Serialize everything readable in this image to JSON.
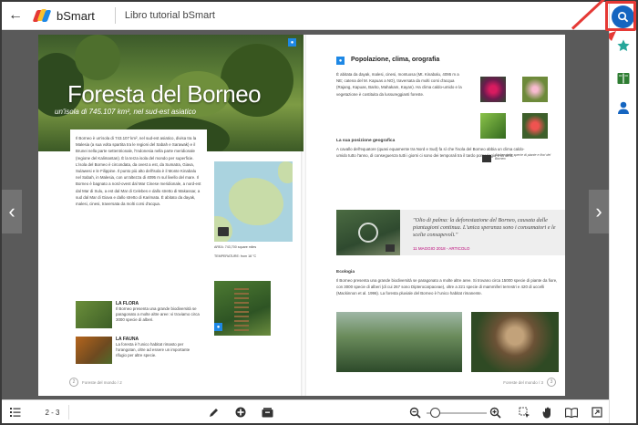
{
  "topbar": {
    "back_icon": "arrow-left-icon",
    "brand": "bSmart",
    "doc_title": "Libro tutorial bSmart"
  },
  "sidebar": {
    "icons": [
      "search-icon",
      "star-icon",
      "book-icon",
      "user-icon"
    ],
    "highlight_color": "#e53935",
    "accent": "#1565c0"
  },
  "left_page": {
    "title": "Foresta del Borneo",
    "subtitle": "un'isola di 745.107 km², nel sud-est asiatico",
    "body": "Il Borneo è un'isola di 743.107 km², nel sud-est asiatico, divisa tra la Malesia (a sua volta spartita tra le regioni del Sabah e Sarawak) e il Brunei nella parte settentrionale, l'Indonesia nella parte meridionale (regione del Kalimantan). È la terza isola del mondo per superficie. L'isola del Borneo è circondata, da ovest a est, da Sumatra, Giava, Sulawesi e le Filippine. Il punto più alto dell'isola è il Monte Kinabalu nel Sabah, in Malesia, con un'altezza di 4095 m sul livello del mare. Il Borneo è bagnato a nord-ovest dal Mar Cinese meridionale, a nord-est dal Mar di Sulu, a est dal Mar di Celebes e dallo stretto di Makassar, a sud dal Mar di Giava e dallo stretto di Karimata. È abitato da dayak, malesi, cinesi, traversata da molti corsi d'acqua.",
    "flora_label": "LA FLORA",
    "flora_text": "Il Borneo presenta una grande biodiversità se paragonato a molte altre aree: vi troviamo circa 3000 specie di alberi.",
    "fauna_label": "LA FAUNA",
    "fauna_text": "La foresta è l'unico habitat rimasto per l'orangotan, oltre ad essere un importante rifugio per altre specie.",
    "map_caption_area": "AREA: 743,700 square miles",
    "map_caption_temp": "TEMPERATURE: from 18 °C",
    "page_footer": "Foreste del mondo / 2"
  },
  "right_page": {
    "heading": "Popolazione, clima, orografia",
    "intro": "È abitata da dayak, malesi, cinesi, montuosa (Mt. Kinabalu, 4095 m a NE; catena del M. Kapuas a NO), traversata da molti corsi d'acqua (Rajang, Kapuas, Barito, Mahakam, Kayan). Ha clima caldo-umido e la vegetazione è costituita da lussureggianti foreste.",
    "subhead_position": "La sua posizione geografica",
    "position_text": "A cavallo dell'equatore (quasi equamente tra Nord e Sud) fa sì che l'isola del Borneo abbia un clima caldo-umido tutto l'anno, di conseguenza tutti i giorni ci sono dei temporali tra il tardo pomeriggio e la sera.",
    "photo_caption": "Alcune delle specie di piante e fiori del Borneo",
    "quote": "\"Olio di palma: la deforestazione del Borneo, causata dalle piantagioni continua. L'unica speranza sono i consumatori e le scelte consapevoli.\"",
    "quote_date": "11 MAGGIO 2018 - ARTICOLO",
    "ecology_head": "Ecologia",
    "ecology_text": "Il Borneo presenta una grande biodiversità se paragonato a molte altre aree. Si trovano circa 15000 specie di piante da fiore, con 3000 specie di alberi (di cui 267 sono Dipterocarpaceae), oltre a 221 specie di mammiferi terrestri e 420 di uccelli (Mackinnon et al. 1996). La foresta pluviale del Borneo è l'unico habitat rimanente.",
    "page_footer": "Foreste del mondo / 3"
  },
  "nav": {
    "prev_icon": "chevron-left-icon",
    "next_icon": "chevron-right-icon"
  },
  "bottombar": {
    "page_indicator": "2 - 3",
    "icons": [
      "list-icon",
      "pen-icon",
      "plus-circle-icon",
      "box-icon",
      "zoom-out-icon",
      "zoom-in-icon",
      "select-icon",
      "hand-icon",
      "open-book-icon",
      "fullscreen-icon"
    ],
    "zoom_level": 0.05
  }
}
